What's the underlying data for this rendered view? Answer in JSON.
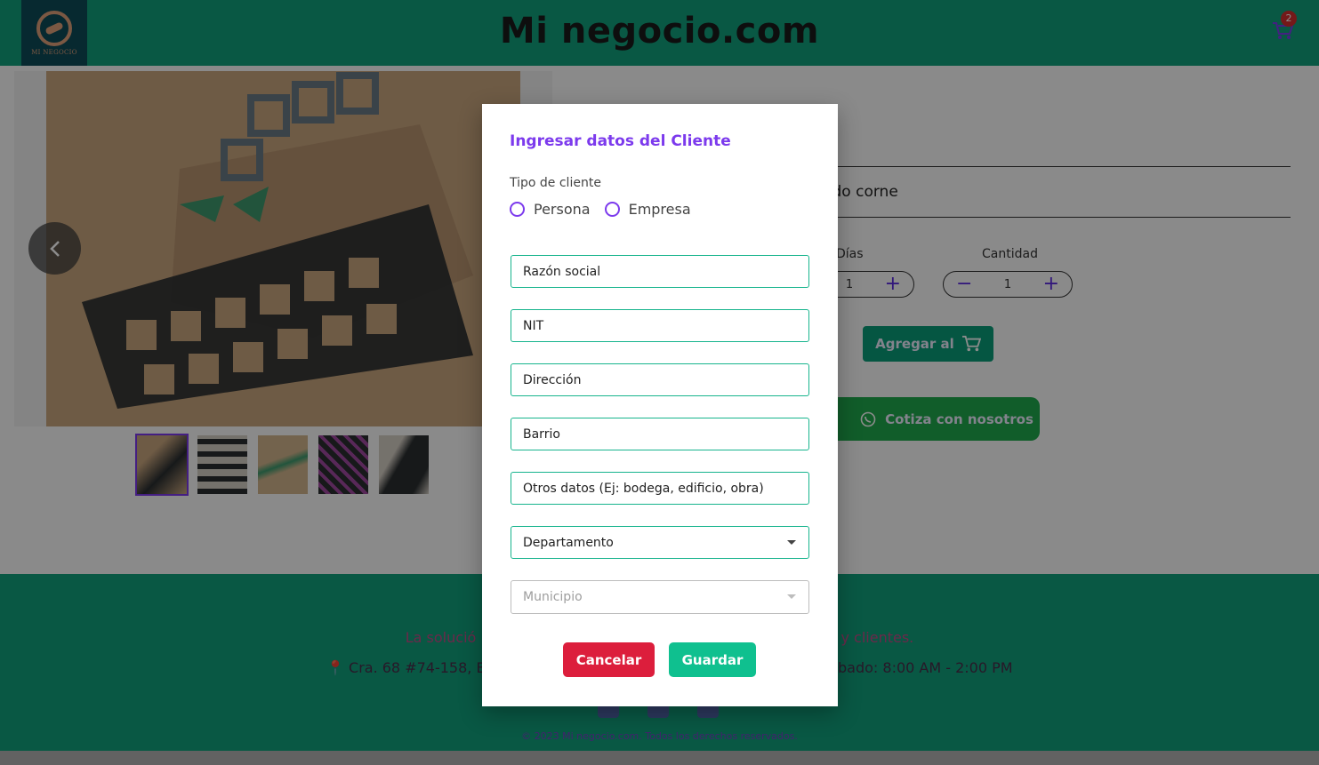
{
  "header": {
    "logo_text": "MI NEGOCIO",
    "site_title": "Mi negocio.com",
    "cart_count": "2"
  },
  "product": {
    "name_fragment": "dido corne",
    "days_label": "Días",
    "days_value": "1",
    "quantity_label": "Cantidad",
    "quantity_value": "1",
    "add_to_cart_label": "Agregar al",
    "quote_label": "Cotiza con nosotros"
  },
  "footer": {
    "slogan_left": "La solució",
    "slogan_right": "y clientes.",
    "address": "Cra. 68 #74-158, Bar",
    "hours": "bado: 8:00 AM - 2:00 PM",
    "copyright": "© 2023 Mi negocio.com. Todos los derechos reservados."
  },
  "modal": {
    "title": "Ingresar datos del Cliente",
    "client_type_label": "Tipo de cliente",
    "options": [
      "Persona",
      "Empresa"
    ],
    "fields": {
      "business_name": "Razón social",
      "nit": "NIT",
      "address": "Dirección",
      "neighborhood": "Barrio",
      "other": "Otros datos (Ej: bodega, edificio, obra)",
      "department": "Departamento",
      "municipality": "Municipio"
    },
    "cancel_label": "Cancelar",
    "save_label": "Guardar"
  },
  "colors": {
    "header": "#11a17d",
    "accent": "#7c3aed",
    "cancel": "#dc1e3c",
    "save": "#0fc08f"
  }
}
